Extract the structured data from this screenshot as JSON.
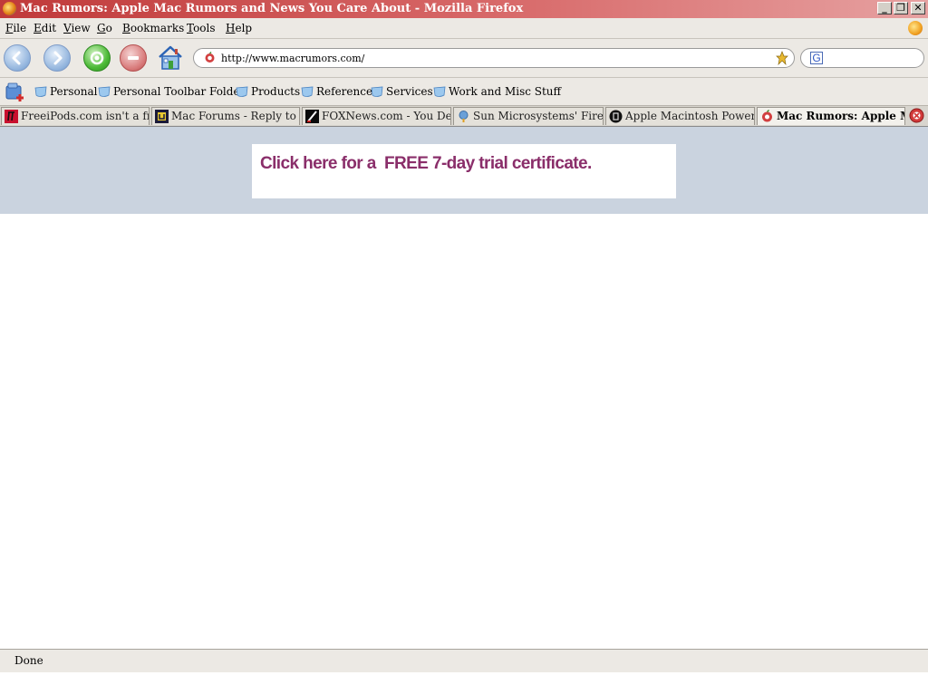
{
  "window": {
    "title": "Mac Rumors: Apple Mac Rumors and News You Care About - Mozilla Firefox",
    "controls": {
      "minimize": "_",
      "maximize": "❐",
      "close": "✕"
    }
  },
  "menu": {
    "items": [
      {
        "underline": "F",
        "rest": "ile"
      },
      {
        "underline": "E",
        "rest": "dit"
      },
      {
        "underline": "V",
        "rest": "iew"
      },
      {
        "underline": "G",
        "rest": "o"
      },
      {
        "underline": "B",
        "rest": "ookmarks"
      },
      {
        "underline": "T",
        "rest": "ools"
      },
      {
        "underline": "H",
        "rest": "elp"
      }
    ]
  },
  "navigation": {
    "url": "http://www.macrumors.com/",
    "search_value": "",
    "search_engine_letter": "G"
  },
  "bookmarks": {
    "items": [
      {
        "label": "Personal"
      },
      {
        "label": "Personal Toolbar Folder"
      },
      {
        "label": "Products"
      },
      {
        "label": "Reference"
      },
      {
        "label": "Services"
      },
      {
        "label": "Work and Misc Stuff"
      }
    ]
  },
  "tabs": [
    {
      "label": "FreeiPods.com isn't a fre...",
      "icon": "freeipods-favicon",
      "active": false
    },
    {
      "label": "Mac Forums - Reply to ...",
      "icon": "macforums-favicon",
      "active": false
    },
    {
      "label": "FOXNews.com - You De...",
      "icon": "foxnews-favicon",
      "active": false
    },
    {
      "label": "Sun Microsystems' Fire ...",
      "icon": "sun-favicon",
      "active": false
    },
    {
      "label": "Apple Macintosh Power...",
      "icon": "apple-favicon",
      "active": false
    },
    {
      "label": "Mac Rumors: Apple Ma...",
      "icon": "macrumors-favicon",
      "active": true
    }
  ],
  "page": {
    "ad_text": "Click here for a  FREE 7-day trial certificate."
  },
  "status": {
    "text": "Done"
  },
  "colors": {
    "title_bar": "#c03a3a",
    "chrome": "#ece9e4",
    "banner_band": "#cad3df",
    "ad_link": "#8a2e6a"
  }
}
